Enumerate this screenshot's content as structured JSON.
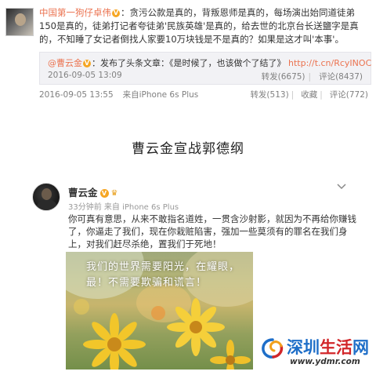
{
  "post1": {
    "author": "中国第一狗仔卓伟",
    "text": "：贪污公款是真的，背叛恩师是真的，每场演出始同道徒弟150是真的，徒弟打记者夸徒弟'民族英雄'是真的，给去世的北京台长送鹽字是真的，不知睡了女记者倒找人家要10万块钱是不是真的？如果是这才叫'本事'。",
    "repost": {
      "author": "@曹云金",
      "action": "：发布了头条文章：《是时候了，也该做个了结了》",
      "link": "http://t.cn/RcyINOC",
      "time": "2016-09-05 13:09",
      "repost_label": "转发(6675)",
      "comment_label": "评论(8437)"
    },
    "time": "2016-09-05 13:55",
    "source": "来自iPhone 6s Plus",
    "repost_label": "转发(513)",
    "fav_label": "收藏",
    "comment_label": "评论(772)"
  },
  "headline": "曹云金宣战郭德纲",
  "post2": {
    "author": "曹云金",
    "meta": "33分钟前 来自 iPhone 6s Plus",
    "text": "你可真有意思，从来不敢指名道姓，一贯含沙射影，就因为不再给你赚钱了，你逼走了我们，现在你栽赃陷害，强加一些莫须有的罪名在我们身上，对我们赶尽杀绝，置我们于死地！",
    "image_caption": "我们的世界需要阳光，在耀眼，最！不需要欺骗和谎言！"
  },
  "watermark": {
    "title_a": "深圳",
    "title_b": "生活",
    "title_c": "网",
    "url": "www.ydmr.com"
  },
  "icons": [
    "chevron-down-icon",
    "verified-icon",
    "crown-icon",
    "swirl-logo-icon"
  ],
  "colors": {
    "author_link": "#eb7350",
    "repost_bg": "#f2f2f5",
    "meta_gray": "#808080",
    "watermark_blue": "#1e6ec8",
    "watermark_red": "#d2262a"
  }
}
